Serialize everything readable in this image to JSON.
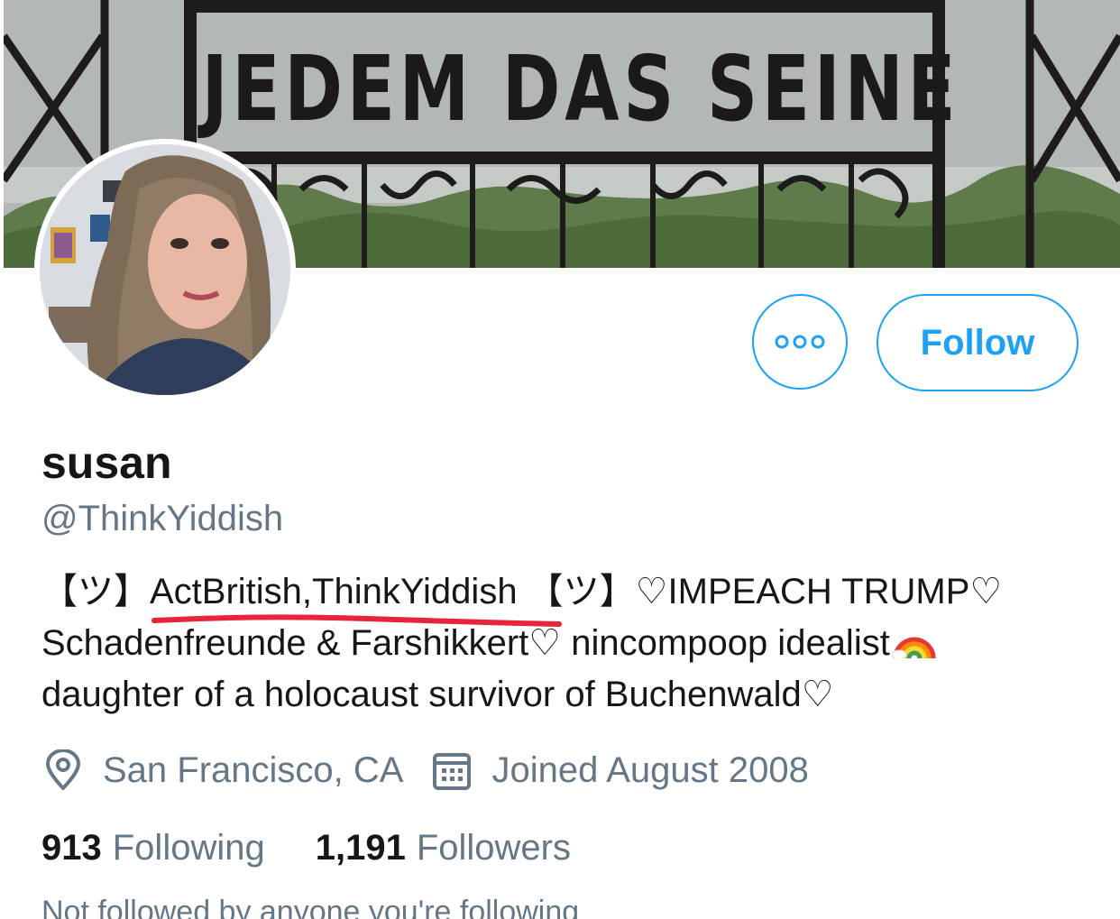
{
  "banner": {
    "sign_text": "JEDEM DAS SEINE"
  },
  "profile": {
    "display_name": "susan",
    "handle": "@ThinkYiddish",
    "bio": {
      "line1_prefix": "【ツ】",
      "line1_highlight": "ActBritish,ThinkYiddish",
      "line1_suffix": " 【ツ】♡IMPEACH TRUMP♡",
      "line2": "Schadenfreunde & Farshikkert♡ nincompoop idealist",
      "line3": "daughter of a holocaust survivor of Buchenwald♡"
    },
    "location": "San Francisco, CA",
    "joined": "Joined August 2008",
    "following_count": "913",
    "following_label": "Following",
    "followers_count": "1,191",
    "followers_label": "Followers",
    "not_followed_text": "Not followed by anyone you're following"
  },
  "actions": {
    "more_label": "More",
    "follow_label": "Follow"
  },
  "colors": {
    "accent": "#1da1f2",
    "secondary_text": "#657786",
    "primary_text": "#14171a",
    "annotation_underline": "#e8243a"
  },
  "icons": {
    "location": "map-pin-icon",
    "joined": "calendar-icon",
    "more": "more-dots-icon",
    "rainbow": "rainbow-emoji-icon"
  }
}
